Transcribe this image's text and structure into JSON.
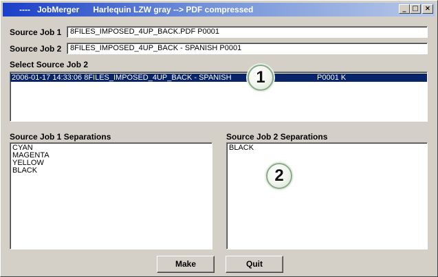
{
  "window": {
    "title": "----   JobMerger      Harlequin LZW gray --> PDF compressed",
    "minimize_glyph": "_",
    "maximize_glyph": "□",
    "close_glyph": "×"
  },
  "source_job_1": {
    "label": "Source Job 1",
    "value": "8FILES_IMPOSED_4UP_BACK.PDF P0001"
  },
  "source_job_2": {
    "label": "Source Job 2",
    "value": "8FILES_IMPOSED_4UP_BACK - SPANISH P0001"
  },
  "select_source_job_2": {
    "label": "Select Source Job 2",
    "selected_row": {
      "text": "2006-01-17  14:33:06  8FILES_IMPOSED_4UP_BACK - SPANISH",
      "code": "P0001 K"
    }
  },
  "separations_1": {
    "label": "Source Job 1 Separations",
    "items": [
      "CYAN",
      "MAGENTA",
      "YELLOW",
      "BLACK"
    ]
  },
  "separations_2": {
    "label": "Source Job 2 Separations",
    "items": [
      "BLACK"
    ]
  },
  "callouts": [
    "1",
    "2"
  ],
  "buttons": {
    "make": "Make",
    "quit": "Quit"
  }
}
